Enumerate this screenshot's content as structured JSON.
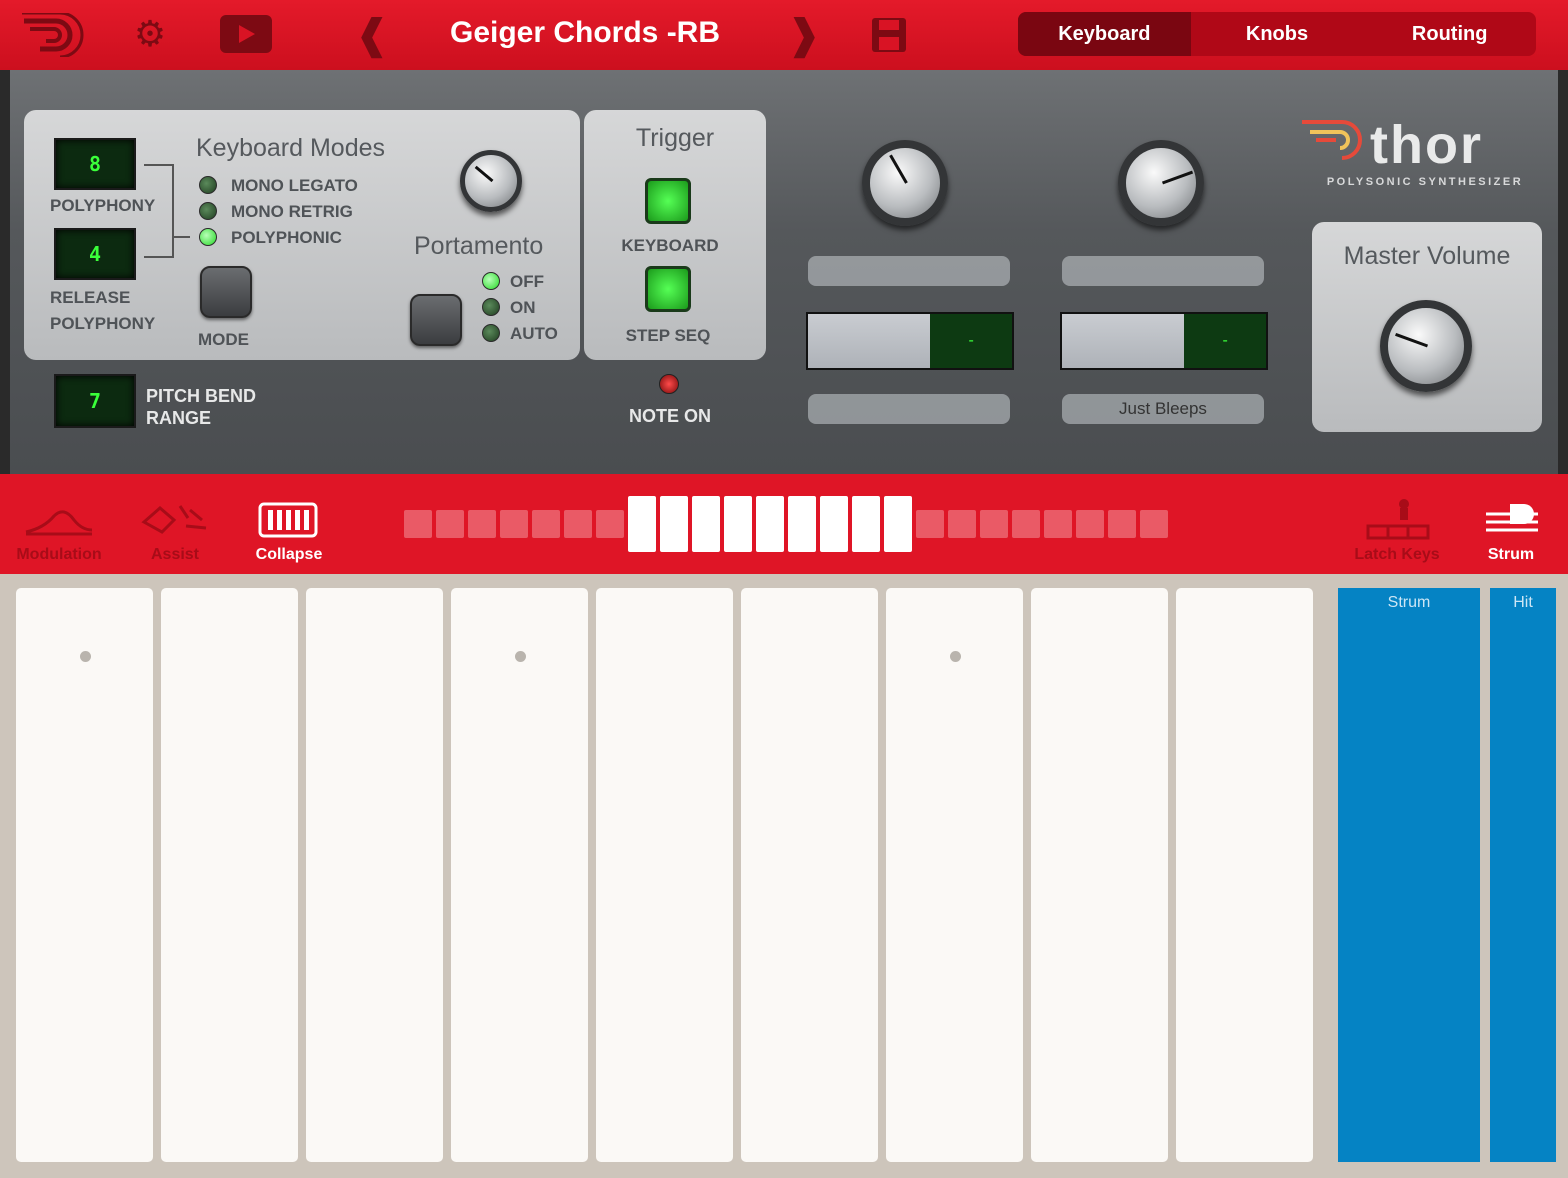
{
  "topbar": {
    "preset_name": "Geiger Chords  -RB",
    "prev_glyph": "❰",
    "next_glyph": "❱",
    "tabs": [
      "Keyboard",
      "Knobs",
      "Routing"
    ],
    "active_tab": "Keyboard"
  },
  "keyboard_modes": {
    "title": "Keyboard Modes",
    "polyphony_value": "8",
    "polyphony_label": "POLYPHONY",
    "release_value": "4",
    "release_label_1": "RELEASE",
    "release_label_2": "POLYPHONY",
    "modes": [
      "MONO LEGATO",
      "MONO RETRIG",
      "POLYPHONIC"
    ],
    "selected_mode": "POLYPHONIC",
    "mode_label": "MODE"
  },
  "portamento": {
    "title": "Portamento",
    "options": [
      "OFF",
      "ON",
      "AUTO"
    ],
    "selected": "OFF"
  },
  "trigger": {
    "title": "Trigger",
    "keyboard_label": "KEYBOARD",
    "stepseq_label": "STEP SEQ",
    "note_on_label": "NOTE ON"
  },
  "pitch_bend": {
    "value": "7",
    "label_1": "PITCH BEND",
    "label_2": "RANGE"
  },
  "assign": {
    "left": {
      "selector_value": "-",
      "bottom_label": ""
    },
    "right": {
      "selector_value": "-",
      "bottom_label": "Just Bleeps"
    }
  },
  "brand": {
    "logo": "thor",
    "subtitle": "POLYSONIC SYNTHESIZER"
  },
  "master_volume": {
    "title": "Master Volume"
  },
  "strip": {
    "modulation": "Modulation",
    "assist": "Assist",
    "collapse": "Collapse",
    "latch_keys": "Latch Keys",
    "strum": "Strum"
  },
  "pads": {
    "strum": "Strum",
    "hit": "Hit"
  },
  "colors": {
    "accent_red": "#df1526",
    "lcd_green": "#3aff3a",
    "pad_blue": "#0583c4"
  }
}
